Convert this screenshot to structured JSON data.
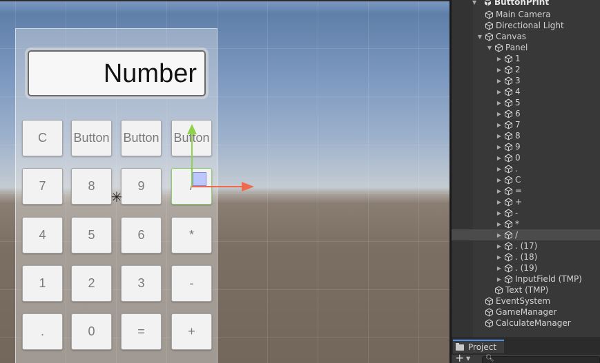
{
  "calculator": {
    "display_text": "Number",
    "rows": [
      [
        "C",
        "Button",
        "Button",
        "Button"
      ],
      [
        "7",
        "8",
        "9",
        "/"
      ],
      [
        "4",
        "5",
        "6",
        "*"
      ],
      [
        "1",
        "2",
        "3",
        "-"
      ],
      [
        ".",
        "0",
        "=",
        "+"
      ]
    ]
  },
  "hierarchy": {
    "root": "ButtonPrint",
    "items": [
      {
        "label": "Main Camera",
        "depth": 1,
        "arrow": "none"
      },
      {
        "label": "Directional Light",
        "depth": 1,
        "arrow": "none"
      },
      {
        "label": "Canvas",
        "depth": 1,
        "arrow": "expanded"
      },
      {
        "label": "Panel",
        "depth": 2,
        "arrow": "expanded"
      },
      {
        "label": "1",
        "depth": 3,
        "arrow": "collapsed"
      },
      {
        "label": "2",
        "depth": 3,
        "arrow": "collapsed"
      },
      {
        "label": "3",
        "depth": 3,
        "arrow": "collapsed"
      },
      {
        "label": "4",
        "depth": 3,
        "arrow": "collapsed"
      },
      {
        "label": "5",
        "depth": 3,
        "arrow": "collapsed"
      },
      {
        "label": "6",
        "depth": 3,
        "arrow": "collapsed"
      },
      {
        "label": "7",
        "depth": 3,
        "arrow": "collapsed"
      },
      {
        "label": "8",
        "depth": 3,
        "arrow": "collapsed"
      },
      {
        "label": "9",
        "depth": 3,
        "arrow": "collapsed"
      },
      {
        "label": "0",
        "depth": 3,
        "arrow": "collapsed"
      },
      {
        "label": ".",
        "depth": 3,
        "arrow": "collapsed"
      },
      {
        "label": "C",
        "depth": 3,
        "arrow": "collapsed"
      },
      {
        "label": "=",
        "depth": 3,
        "arrow": "collapsed"
      },
      {
        "label": "+",
        "depth": 3,
        "arrow": "collapsed"
      },
      {
        "label": "-",
        "depth": 3,
        "arrow": "collapsed"
      },
      {
        "label": "*",
        "depth": 3,
        "arrow": "collapsed"
      },
      {
        "label": "/",
        "depth": 3,
        "arrow": "collapsed",
        "selected": true
      },
      {
        "label": ". (17)",
        "depth": 3,
        "arrow": "collapsed"
      },
      {
        "label": ". (18)",
        "depth": 3,
        "arrow": "collapsed"
      },
      {
        "label": ". (19)",
        "depth": 3,
        "arrow": "collapsed"
      },
      {
        "label": "InputField (TMP)",
        "depth": 3,
        "arrow": "collapsed"
      },
      {
        "label": "Text (TMP)",
        "depth": 2,
        "arrow": "none"
      },
      {
        "label": "EventSystem",
        "depth": 1,
        "arrow": "none"
      },
      {
        "label": "GameManager",
        "depth": 1,
        "arrow": "none"
      },
      {
        "label": "CalculateManager",
        "depth": 1,
        "arrow": "none"
      }
    ]
  },
  "project": {
    "tab_label": "Project",
    "add_label": "+"
  },
  "icons": {
    "cube": "cube-icon",
    "root": "unity-scene-icon",
    "light": "light-gizmo-icon",
    "search": "search-icon",
    "folder": "folder-icon"
  },
  "colors": {
    "selected_row": "#4b4b4b",
    "gizmo_y": "#8fd34b",
    "gizmo_x": "#ef6a4d",
    "tab_accent": "#4d8ee6"
  }
}
